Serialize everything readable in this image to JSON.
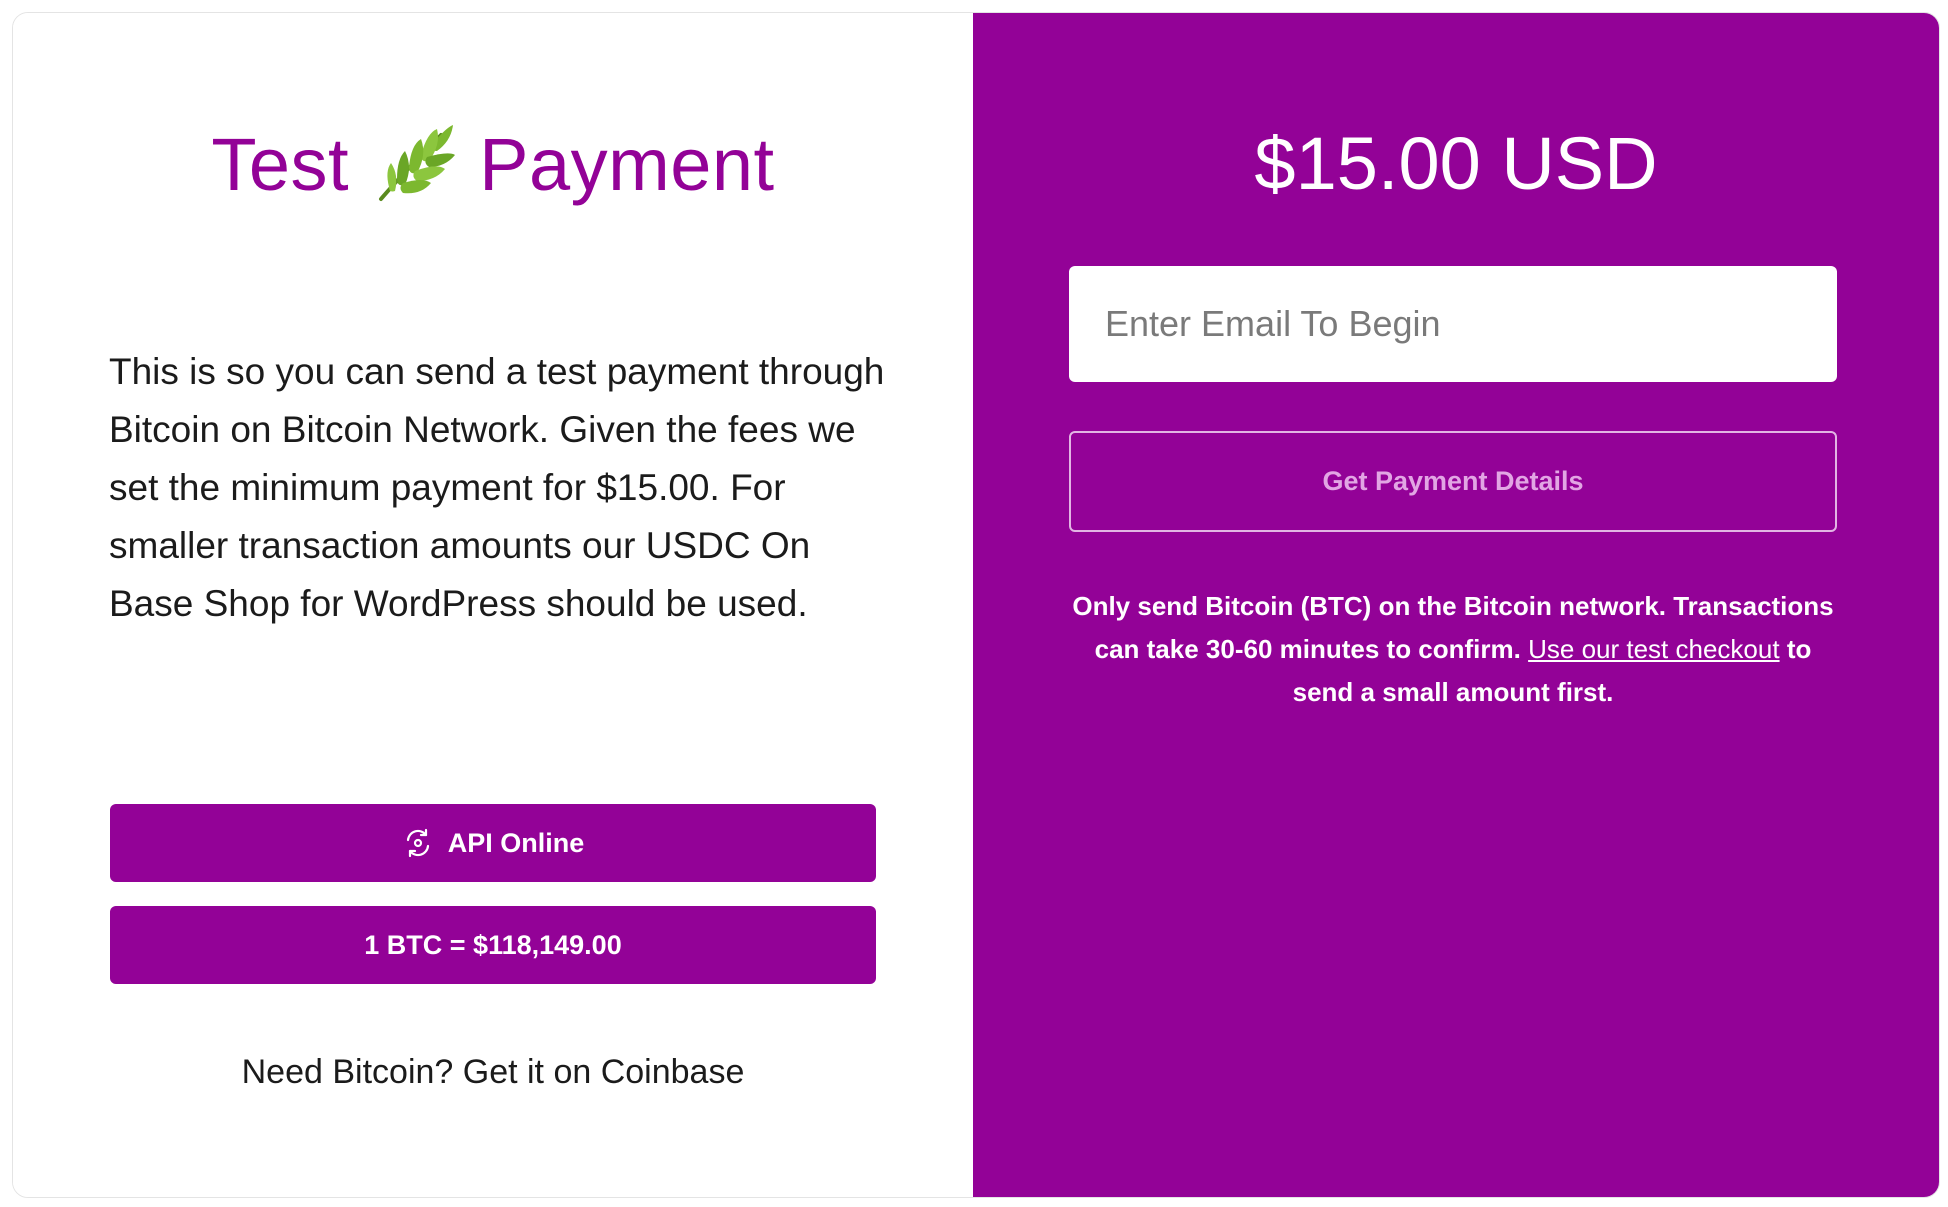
{
  "left": {
    "title_before": "Test",
    "title_after": "Payment",
    "title_icon": "leaf-icon",
    "description": "This is so you can send a test payment through Bitcoin on Bitcoin Network. Given the fees we set the minimum payment for $15.00. For smaller transaction amounts our USDC On Base Shop for WordPress should be used.",
    "api_status_label": "API Online",
    "api_status_icon": "sync-icon",
    "rate_label": "1 BTC = $118,149.00",
    "coinbase_link": "Need Bitcoin? Get it on Coinbase"
  },
  "right": {
    "amount": "$15.00 USD",
    "email_placeholder": "Enter Email To Begin",
    "details_button": "Get Payment Details",
    "notice_text": "Only send Bitcoin (BTC) on the Bitcoin network. Transactions can take 30-60 minutes to confirm.",
    "notice_link": "Use our test checkout",
    "notice_text_after": "to send a small amount first."
  },
  "colors": {
    "brand": "#930297",
    "text": "#1b1b1b",
    "white": "#ffffff"
  }
}
